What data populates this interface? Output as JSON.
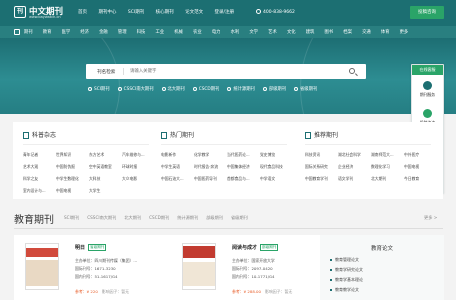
{
  "brand": {
    "mark": "刊",
    "name": "中文期刊",
    "url": "www.baywatch.cn"
  },
  "nav": [
    "首页",
    "期刊中心",
    "SCI期刊",
    "核心期刊",
    "论文范文",
    "登录/注册"
  ],
  "phone": "400-838-9662",
  "contribute_label": "投稿咨询",
  "subjects": [
    "期刊",
    "教育",
    "医学",
    "经济",
    "金融",
    "管理",
    "科技",
    "工业",
    "机械",
    "农业",
    "电力",
    "水利",
    "文学",
    "艺术",
    "文化",
    "建筑",
    "图书",
    "档案",
    "交通",
    "体育",
    "更多"
  ],
  "search": {
    "category": "刊名检索",
    "placeholder": "请输入关键字"
  },
  "databases": [
    "SCI期刊",
    "CSSCI南大期刊",
    "北大期刊",
    "CSCD期刊",
    "统计源期刊",
    "部级期刊",
    "省级期刊"
  ],
  "sidefloat": {
    "header": "在线客服",
    "items": [
      "期刊服务",
      "投稿咨询",
      "免费咨询",
      "文献服务"
    ]
  },
  "features": [
    {
      "title": "科普杂志",
      "items": [
        "青年记者",
        "世界知识",
        "东方艺术",
        "汽车维修与...",
        "艺术大观",
        "中国防伪报",
        "空中英语教室",
        "环球时报",
        "科学之友",
        "中学生数理化",
        "大科技",
        "大众电影",
        "室内设计与...",
        "中国电视",
        "大学生"
      ]
    },
    {
      "title": "热门期刊",
      "items": [
        "电影新作",
        "化学教学",
        "当代医药论...",
        "党史博览",
        "中学生英语",
        "时代报告·奔流",
        "中国集体经济",
        "现代食品科技",
        "中国石油大...",
        "中国医药导刊",
        "首都食品与...",
        "中学语文"
      ]
    },
    {
      "title": "推荐期刊",
      "items": [
        "科技资讯",
        "湖北社会科学",
        "湖南师范大...",
        "中外医疗",
        "国际关系研究",
        "企业经济",
        "数理化学习",
        "中国电视",
        "中国教育学刊",
        "语文学刊",
        "北大期刊",
        "今日教育"
      ]
    }
  ],
  "section": {
    "title": "教育期刊",
    "tabs": [
      "SCI期刊",
      "CSSCI南大期刊",
      "北大期刊",
      "CSCD期刊",
      "统计源期刊",
      "部级期刊",
      "省级期刊"
    ],
    "more": "更多 >"
  },
  "journals": [
    {
      "name": "明日",
      "tag": "省级期刊",
      "org": "主办单位：四川期刊传媒（集团）...",
      "issn": "国际刊号：1671-3230",
      "cn": "国内刊号：51-1617/G4",
      "price": "参考：¥ 220",
      "factor": "影响因子：暂无"
    },
    {
      "name": "阅读与成才",
      "tag": "部级期刊",
      "org": "主办单位：国家开放大学",
      "issn": "国际刊号：2097-0420",
      "cn": "国内刊号：10-1771/G4",
      "price": "参考：¥ 288.00",
      "factor": "影响因子：暂无"
    }
  ],
  "edu_panel": {
    "title": "教育论文",
    "items": [
      "教育管理论文",
      "教育学研究论文",
      "教育学基本理论",
      "教育教学论文"
    ]
  },
  "colors": {
    "primary": "#1c6f72",
    "accent": "#2aa468",
    "price": "#e8602c"
  }
}
